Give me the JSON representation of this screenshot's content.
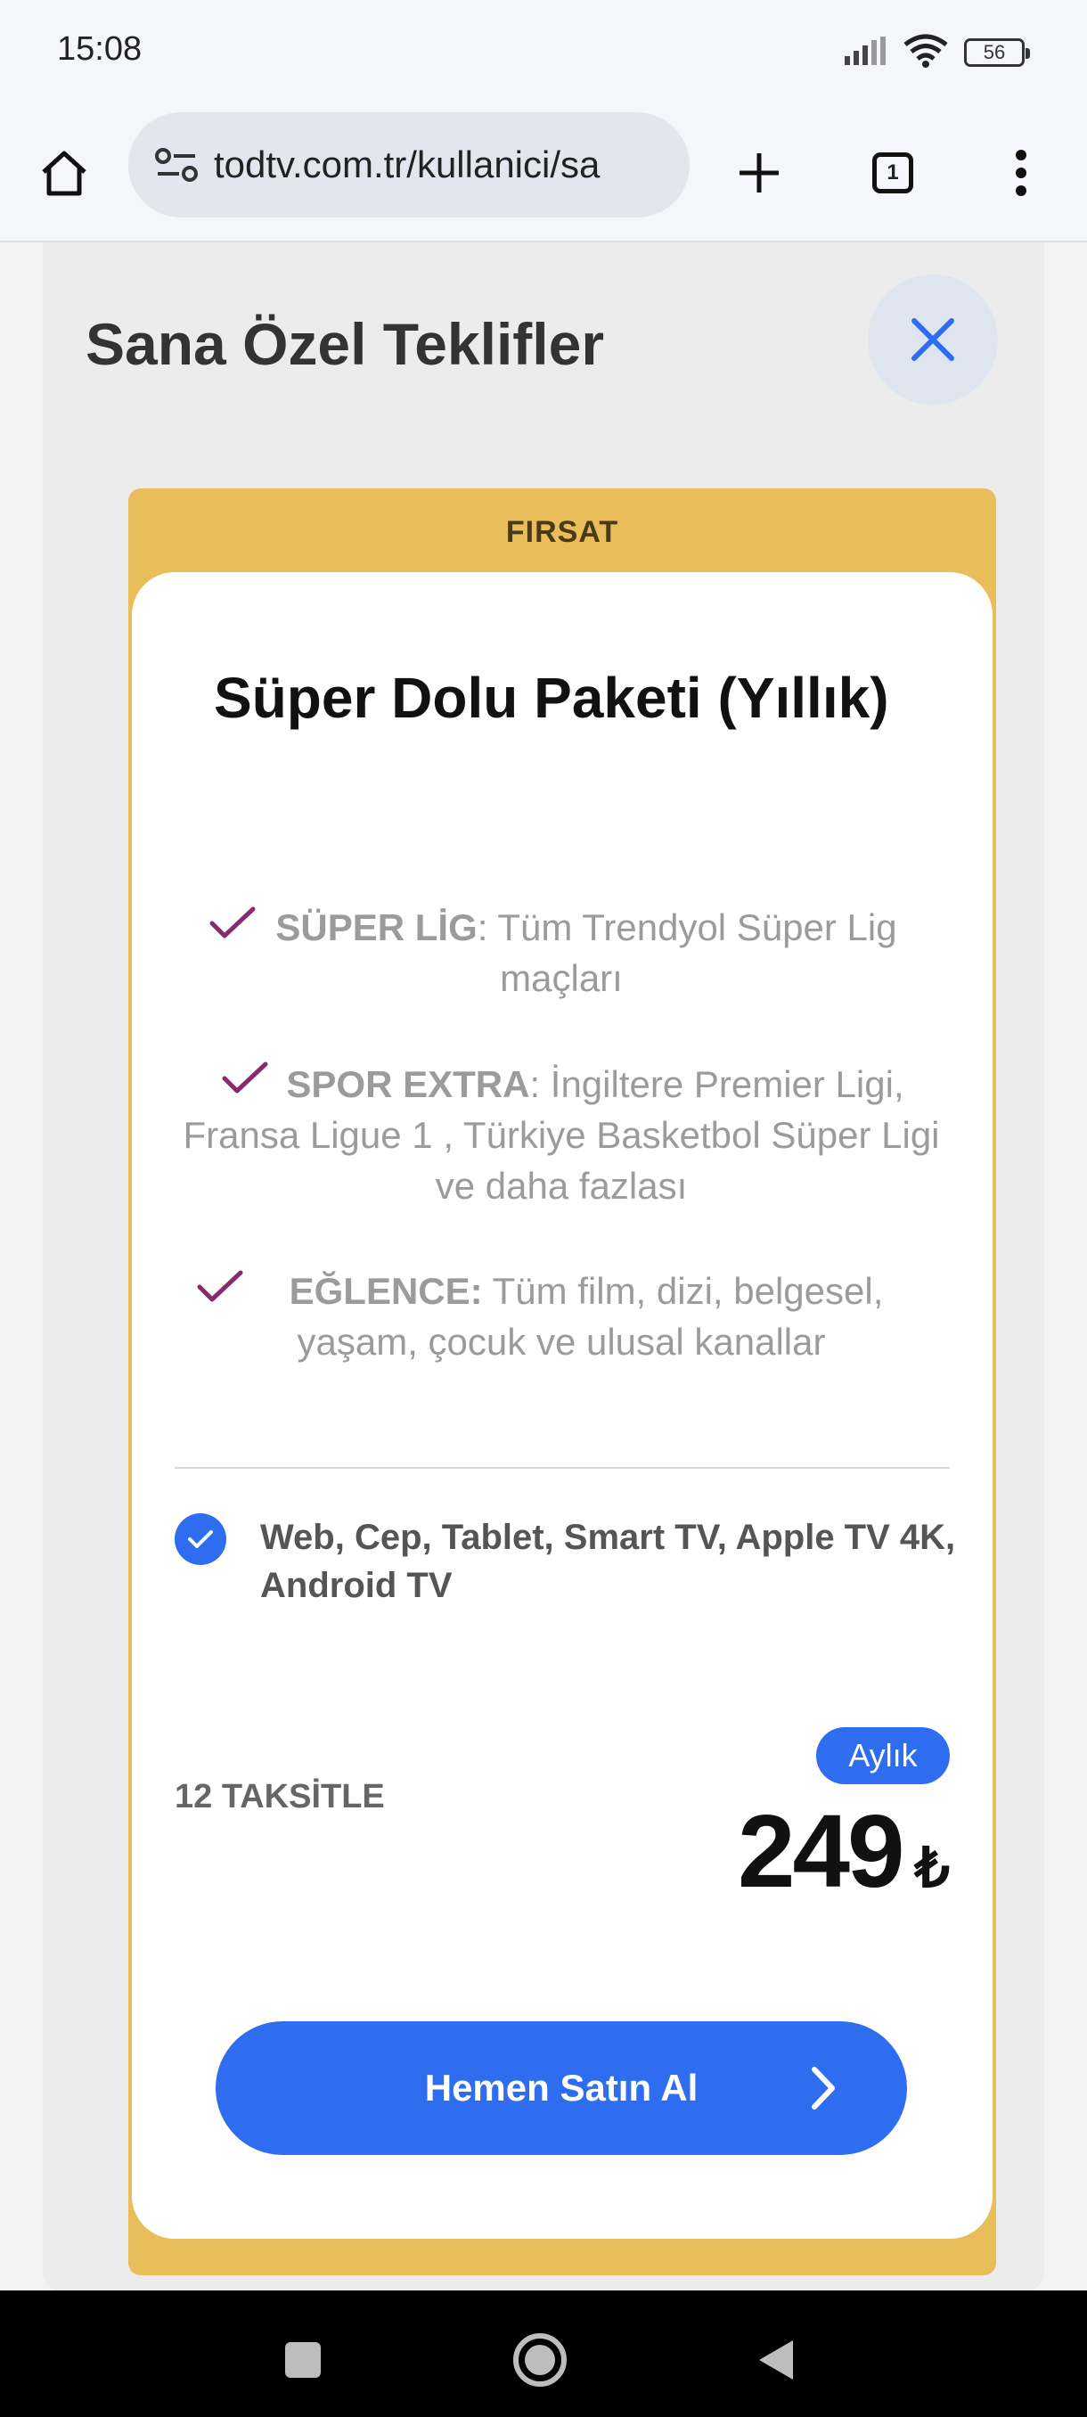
{
  "status_bar": {
    "time": "15:08",
    "battery": "56"
  },
  "browser": {
    "url": "todtv.com.tr/kullanici/sa",
    "tab_count": "1"
  },
  "panel": {
    "title": "Sana Özel Teklifler"
  },
  "offer": {
    "badge": "FIRSAT",
    "title": "Süper Dolu Paketi (Yıllık)",
    "features": [
      {
        "name": "SÜPER LİG",
        "sep": ": ",
        "desc": "Tüm Trendyol Süper Lig maçları"
      },
      {
        "name": "SPOR EXTRA",
        "sep": ": ",
        "desc": "İngiltere Premier Ligi, Fransa Ligue 1 , Türkiye Basketbol Süper Ligi ve daha fazlası"
      },
      {
        "name": "EĞLENCE:",
        "sep": " ",
        "desc": "Tüm film, dizi, belgesel, yaşam, çocuk ve ulusal kanallar"
      }
    ],
    "devices": "Web, Cep, Tablet, Smart TV, Apple TV 4K, Android TV",
    "installments": "12 TAKSİTLE",
    "period": "Aylık",
    "price": "249",
    "currency": "₺",
    "buy_label": "Hemen Satın Al"
  },
  "colors": {
    "accent": "#2f6df0",
    "badge_bg": "#e8bd5a",
    "check": "#8a2a6e"
  }
}
